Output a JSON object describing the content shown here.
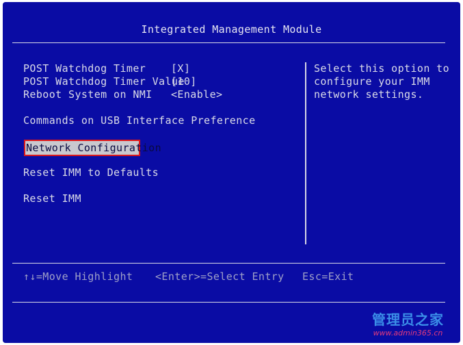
{
  "title": "Integrated Management Module",
  "settings": [
    {
      "label": "POST Watchdog Timer",
      "value": "[X]"
    },
    {
      "label": "POST Watchdog Timer Value",
      "value": "[10]"
    },
    {
      "label": "Reboot System on NMI",
      "value": "<Enable>"
    }
  ],
  "menu": {
    "usb_pref": "Commands on USB Interface Preference",
    "network_config": "Network Configuration",
    "reset_defaults": "Reset IMM to Defaults",
    "reset_imm": "Reset IMM"
  },
  "help_text": "Select this option to\nconfigure your IMM\nnetwork settings.",
  "footer": {
    "move": "↑↓=Move Highlight",
    "select": "<Enter>=Select Entry",
    "exit": "Esc=Exit"
  },
  "watermark": {
    "main": "管理员之家",
    "sub": "www.admin365.cn"
  },
  "colors": {
    "background": "#0a0ca4",
    "highlight_border": "#e01818",
    "highlight_bg": "#c9c9cf"
  }
}
